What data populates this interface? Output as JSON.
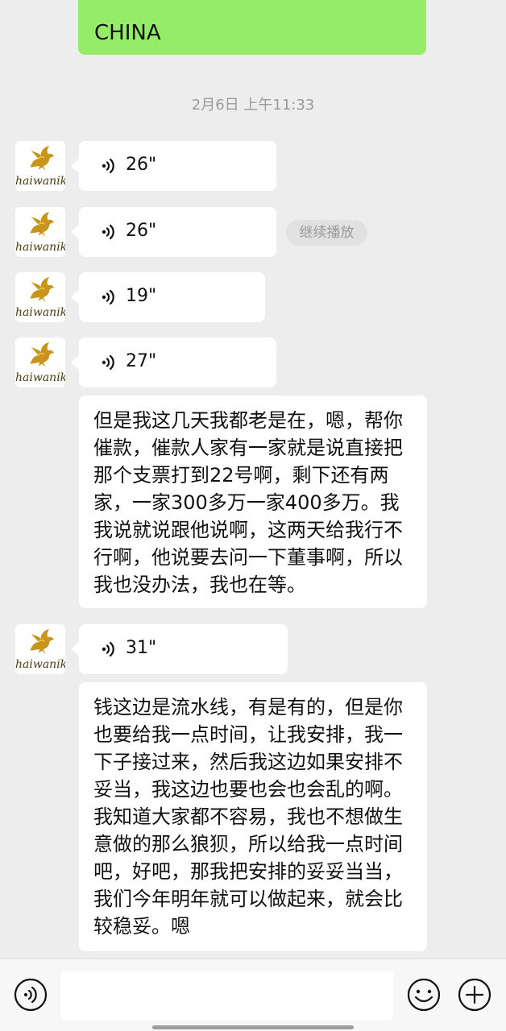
{
  "previous_message": {
    "text": "CHINA"
  },
  "timestamp": "2月6日 上午11:33",
  "avatar_brand": "haiwanik",
  "voice_messages": [
    {
      "duration": "26\""
    },
    {
      "duration": "26\""
    },
    {
      "duration": "19\""
    },
    {
      "duration": "27\""
    },
    {
      "duration": "31\""
    }
  ],
  "continue_play_label": "继续播放",
  "text_messages": [
    {
      "text": "但是我这几天我都老是在，嗯，帮你催款，催款人家有一家就是说直接把那个支票打到22号啊，剩下还有两家，一家300多万一家400多万。我我说就说跟他说啊，这两天给我行不行啊，他说要去问一下董事啊，所以我也没办法，我也在等。"
    },
    {
      "text": "钱这边是流水线，有是有的，但是你也要给我一点时间，让我安排，我一下子接过来，然后我这边如果安排不妥当，我这边也要也会也会乱的啊。我知道大家都不容易，我也不想做生意做的那么狼狈，所以给我一点时间吧，好吧，那我把安排的妥妥当当，我们今年明年就可以做起来，就会比较稳妥。嗯"
    }
  ],
  "colors": {
    "sent_bubble": "#95ec69",
    "received_bubble": "#ffffff",
    "background": "#ededed"
  },
  "icons": [
    "voice-wave-icon",
    "voice-mode-icon",
    "emoji-icon",
    "plus-icon"
  ]
}
